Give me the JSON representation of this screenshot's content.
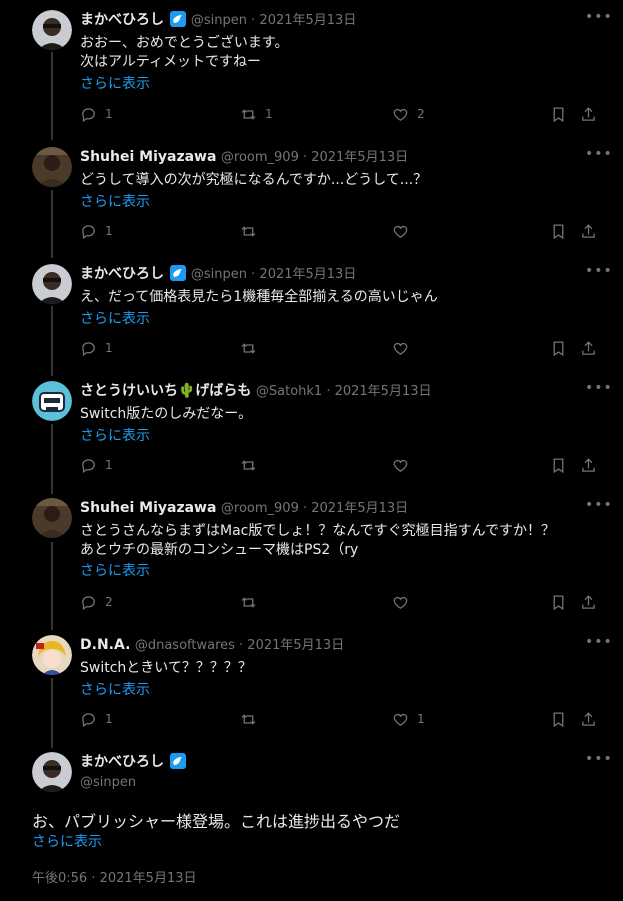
{
  "replies": [
    {
      "name": "まかべひろし",
      "verified": true,
      "handle_line": "@sinpen · 2021年5月13日",
      "text": "おおー、おめでとうございます。\n次はアルティメットですねー",
      "show_more": "さらに表示",
      "reply_count": "1",
      "retweet_count": "1",
      "like_count": "2"
    },
    {
      "name": "Shuhei Miyazawa",
      "verified": false,
      "handle_line": "@room_909 · 2021年5月13日",
      "text": "どうして導入の次が究極になるんですか...どうして...？",
      "show_more": "さらに表示",
      "reply_count": "1",
      "retweet_count": "",
      "like_count": ""
    },
    {
      "name": "まかべひろし",
      "verified": true,
      "handle_line": "@sinpen · 2021年5月13日",
      "text": "え、だって価格表見たら1機種毎全部揃えるの高いじゃん",
      "show_more": "さらに表示",
      "reply_count": "1",
      "retweet_count": "",
      "like_count": ""
    },
    {
      "name": "さとうけいいち🌵げばらも",
      "verified": false,
      "handle_line": "@Satohk1 · 2021年5月13日",
      "text": "Switch版たのしみだなー。",
      "show_more": "さらに表示",
      "reply_count": "1",
      "retweet_count": "",
      "like_count": ""
    },
    {
      "name": "Shuhei Miyazawa",
      "verified": false,
      "handle_line": "@room_909 · 2021年5月13日",
      "text": "さとうさんならまずはMac版でしょ！？なんですぐ究極目指すんですか！？\nあとウチの最新のコンシューマ機はPS2（ry",
      "show_more": "さらに表示",
      "reply_count": "2",
      "retweet_count": "",
      "like_count": ""
    },
    {
      "name": "D.N.A.",
      "verified": false,
      "handle_line": "@dnasoftwares · 2021年5月13日",
      "text": "Switchときいて？？？？？",
      "show_more": "さらに表示",
      "reply_count": "1",
      "retweet_count": "",
      "like_count": "1"
    }
  ],
  "main": {
    "name": "まかべひろし",
    "verified": true,
    "handle": "@sinpen",
    "text": "お、パブリッシャー様登場。これは進捗出るやつだ",
    "show_more": "さらに表示",
    "timestamp": "午後0:56 · 2021年5月13日"
  },
  "icons": {
    "more": "more-icon",
    "reply": "reply-icon",
    "retweet": "retweet-icon",
    "like": "like-icon",
    "bookmark": "bookmark-icon",
    "share": "share-icon",
    "verified": "verified-badge-icon"
  },
  "colors": {
    "link": "#1d9bf0",
    "muted": "#71767b",
    "text": "#e7e9ea",
    "background": "#000000",
    "verified": "#1d9bf0"
  }
}
